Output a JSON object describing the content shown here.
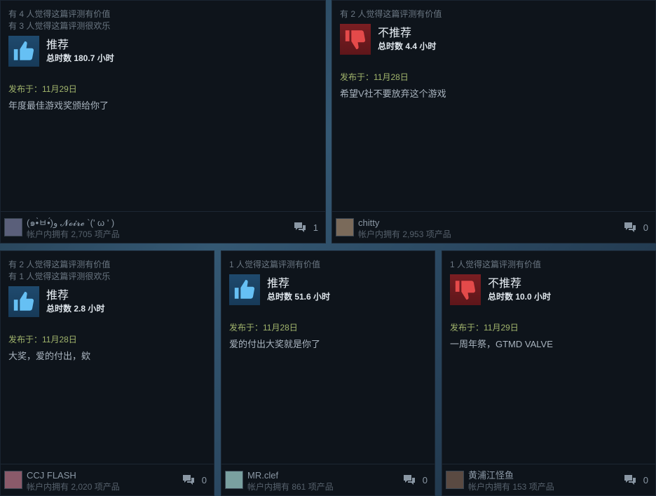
{
  "labels": {
    "posted_prefix": "发布于："
  },
  "reviews": [
    {
      "helpful": "有 4 人觉得这篇评测有价值",
      "funny": "有 3 人觉得这篇评测很欢乐",
      "verdict": "推荐",
      "recommended": true,
      "hours": "总时数 180.7 小时",
      "posted": "发布于：11月29日",
      "text": "年度最佳游戏奖颁给你了",
      "user": "(๑•̀ㅂ•́)و 𝓝𝓸𝓲𝓻𝓮 `(' ω ' )",
      "products": "帐户内拥有 2,705 项产品",
      "comments": "1",
      "avatar_color": "#5a5f7a"
    },
    {
      "helpful": "有 2 人觉得这篇评测有价值",
      "funny": "",
      "verdict": "不推荐",
      "recommended": false,
      "hours": "总时数 4.4 小时",
      "posted": "发布于：11月28日",
      "text": "希望V社不要放弃这个游戏",
      "user": "chitty",
      "products": "帐户内拥有 2,953 项产品",
      "comments": "0",
      "avatar_color": "#7a6a5a"
    },
    {
      "helpful": "有 2 人觉得这篇评测有价值",
      "funny": "有 1 人觉得这篇评测很欢乐",
      "verdict": "推荐",
      "recommended": true,
      "hours": "总时数 2.8 小时",
      "posted": "发布于：11月28日",
      "text": "大奖，爱的付出，欸",
      "user": "CCJ FLASH",
      "products": "帐户内拥有 2,020 项产品",
      "comments": "0",
      "avatar_color": "#8a5a6a"
    },
    {
      "helpful": "1 人觉得这篇评测有价值",
      "funny": "",
      "verdict": "推荐",
      "recommended": true,
      "hours": "总时数 51.6 小时",
      "posted": "发布于：11月28日",
      "text": "爱的付出大奖就是你了",
      "user": "MR.clef",
      "products": "帐户内拥有 861 项产品",
      "comments": "0",
      "avatar_color": "#7aa0a0"
    },
    {
      "helpful": "1 人觉得这篇评测有价值",
      "funny": "",
      "verdict": "不推荐",
      "recommended": false,
      "hours": "总时数 10.0 小时",
      "posted": "发布于：11月29日",
      "text": "一周年祭，GTMD VALVE",
      "user": "黄浦江怪鱼",
      "products": "帐户内拥有 153 项产品",
      "comments": "0",
      "avatar_color": "#5a4a42"
    }
  ],
  "colors": {
    "card_bg": "#0e141b",
    "recommended_blue": "#66c0f4",
    "not_recommended_red": "#e44a4a",
    "posted_green": "#a1b56c"
  },
  "icons": {
    "thumbs_up": "thumbs-up-icon",
    "thumbs_down": "thumbs-down-icon",
    "comment": "comment-icon"
  }
}
